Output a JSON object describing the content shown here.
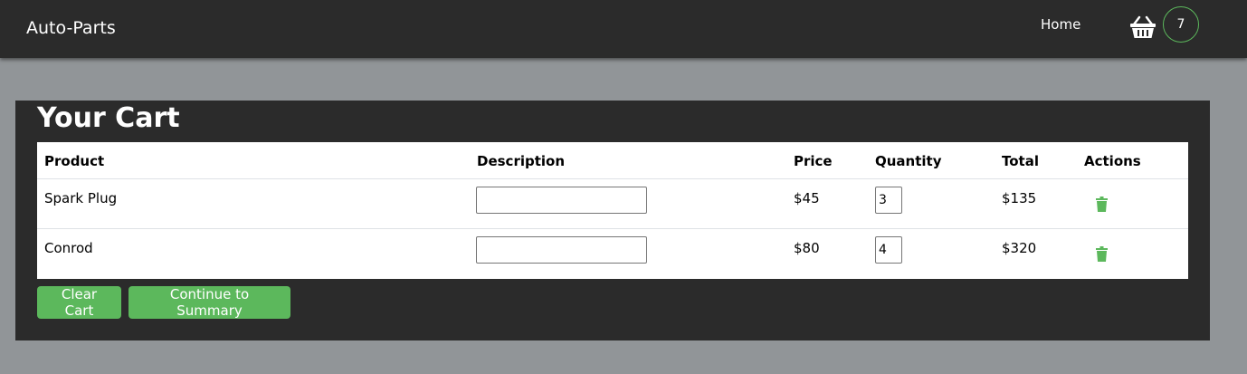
{
  "navbar": {
    "brand": "Auto-Parts",
    "home_label": "Home",
    "cart_icon": "basket-icon",
    "cart_count": "7"
  },
  "cart": {
    "title": "Your Cart",
    "columns": [
      "Product",
      "Description",
      "Price",
      "Quantity",
      "Total",
      "Actions"
    ],
    "rows": [
      {
        "product": "Spark Plug",
        "description": "",
        "price": "$45",
        "quantity": "3",
        "total": "$135",
        "action_icon": "trash-icon"
      },
      {
        "product": "Conrod",
        "description": "",
        "price": "$80",
        "quantity": "4",
        "total": "$320",
        "action_icon": "trash-icon"
      }
    ],
    "clear_label": "Clear Cart",
    "continue_label": "Continue to Summary"
  },
  "colors": {
    "nav_bg": "#2b2b2b",
    "page_bg": "#919598",
    "accent": "#5cb85c"
  }
}
